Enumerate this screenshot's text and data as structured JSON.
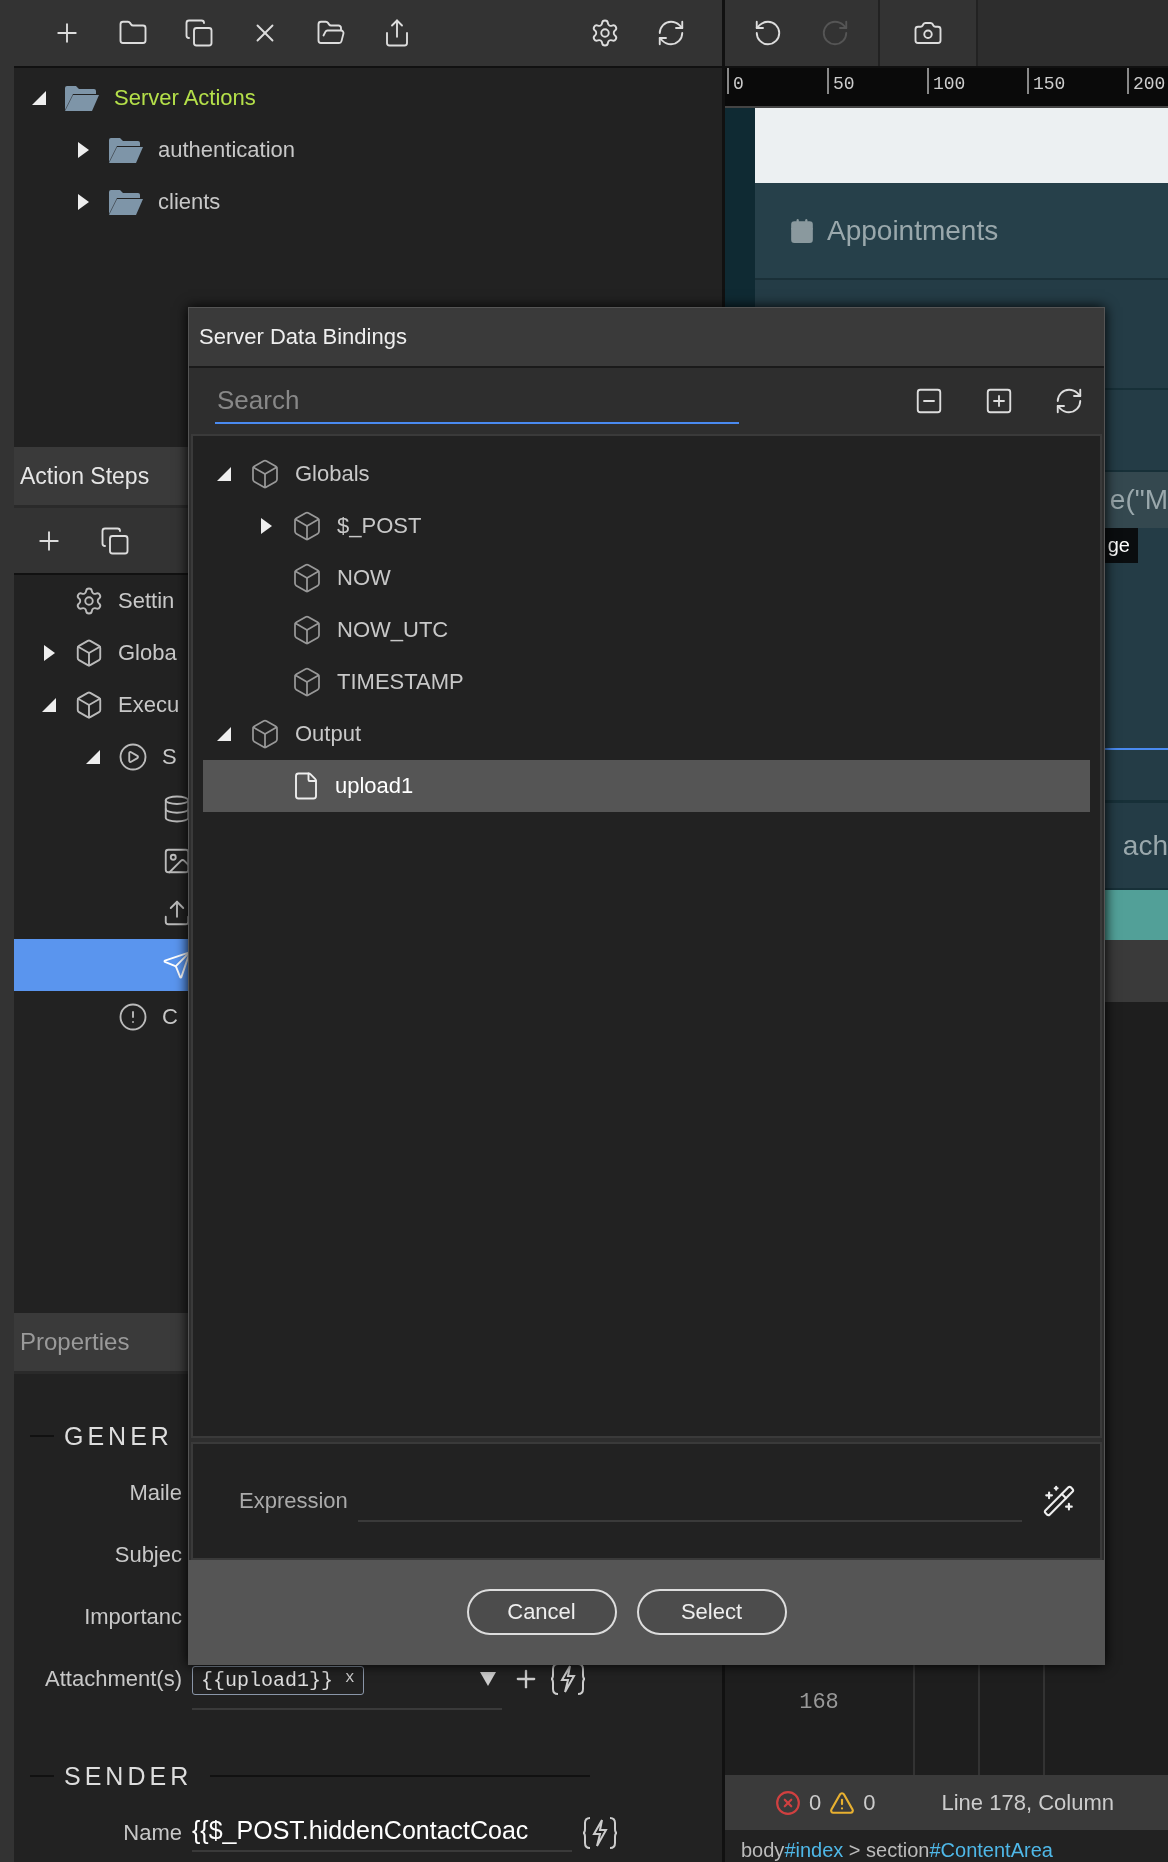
{
  "history": {
    "redo_enabled": false
  },
  "file_tree": [
    {
      "label": "Server Actions",
      "expanded": true,
      "selected": true,
      "children": [
        {
          "label": "authentication",
          "expanded": false,
          "selected": false
        },
        {
          "label": "clients",
          "expanded": false,
          "selected": false
        }
      ]
    }
  ],
  "ruler": {
    "ticks": [
      "0",
      "50",
      "100",
      "150",
      "200"
    ]
  },
  "preview": {
    "heading": "Appointments",
    "code_fragment": "e(\"M",
    "tooltip": "ge",
    "button_fragment": "ach"
  },
  "action_steps": {
    "title": "Action Steps",
    "items": [
      {
        "kind": "settings",
        "label": "Settin",
        "selected": false
      },
      {
        "kind": "globals",
        "label": "Globa",
        "expanded": false,
        "selected": false
      },
      {
        "kind": "execute",
        "label": "Execu",
        "expanded": true,
        "selected": false,
        "children": [
          {
            "kind": "step",
            "label": "S",
            "expanded": true,
            "selected": false,
            "children": [
              {
                "kind": "database",
                "selected": false
              },
              {
                "kind": "image",
                "selected": false
              },
              {
                "kind": "upload",
                "selected": false
              },
              {
                "kind": "send",
                "selected": true
              }
            ]
          },
          {
            "kind": "error",
            "label": "C",
            "selected": false
          }
        ]
      }
    ]
  },
  "properties": {
    "title": "Properties",
    "sections": [
      {
        "title": "GENER",
        "fields": [
          {
            "kind": "label",
            "label": "Maile"
          },
          {
            "kind": "label",
            "label": "Subjec"
          },
          {
            "kind": "label",
            "label": "Importanc"
          },
          {
            "kind": "tags",
            "label": "Attachment(s)",
            "tags": [
              {
                "text": "{{upload1}}",
                "remove": "x"
              }
            ]
          }
        ]
      },
      {
        "title": "SENDER",
        "fields": [
          {
            "kind": "text",
            "label": "Name",
            "value": "{{$_POST.hiddenContactCoac"
          }
        ]
      }
    ]
  },
  "code": {
    "line_numbers": [
      "168"
    ]
  },
  "status_bar": {
    "errors": "0",
    "warnings": "0",
    "position": "Line 178, Column"
  },
  "breadcrumb": [
    {
      "tag": "body",
      "id": "#index"
    },
    {
      "tag": " > section",
      "id": "#ContentArea"
    }
  ],
  "dialog": {
    "title": "Server Data Bindings",
    "search": {
      "placeholder": "Search"
    },
    "tree": [
      {
        "label": "Globals",
        "kind": "folder",
        "expanded": true,
        "selected": false,
        "children": [
          {
            "label": "$_POST",
            "kind": "folder",
            "expanded": false,
            "selected": false
          },
          {
            "label": "NOW",
            "kind": "item",
            "selected": false
          },
          {
            "label": "NOW_UTC",
            "kind": "item",
            "selected": false
          },
          {
            "label": "TIMESTAMP",
            "kind": "item",
            "selected": false
          }
        ]
      },
      {
        "label": "Output",
        "kind": "folder",
        "expanded": true,
        "selected": false,
        "children": [
          {
            "label": "upload1",
            "kind": "file",
            "selected": true
          }
        ]
      }
    ],
    "expression": {
      "label": "Expression"
    },
    "buttons": [
      "Cancel",
      "Select"
    ]
  }
}
